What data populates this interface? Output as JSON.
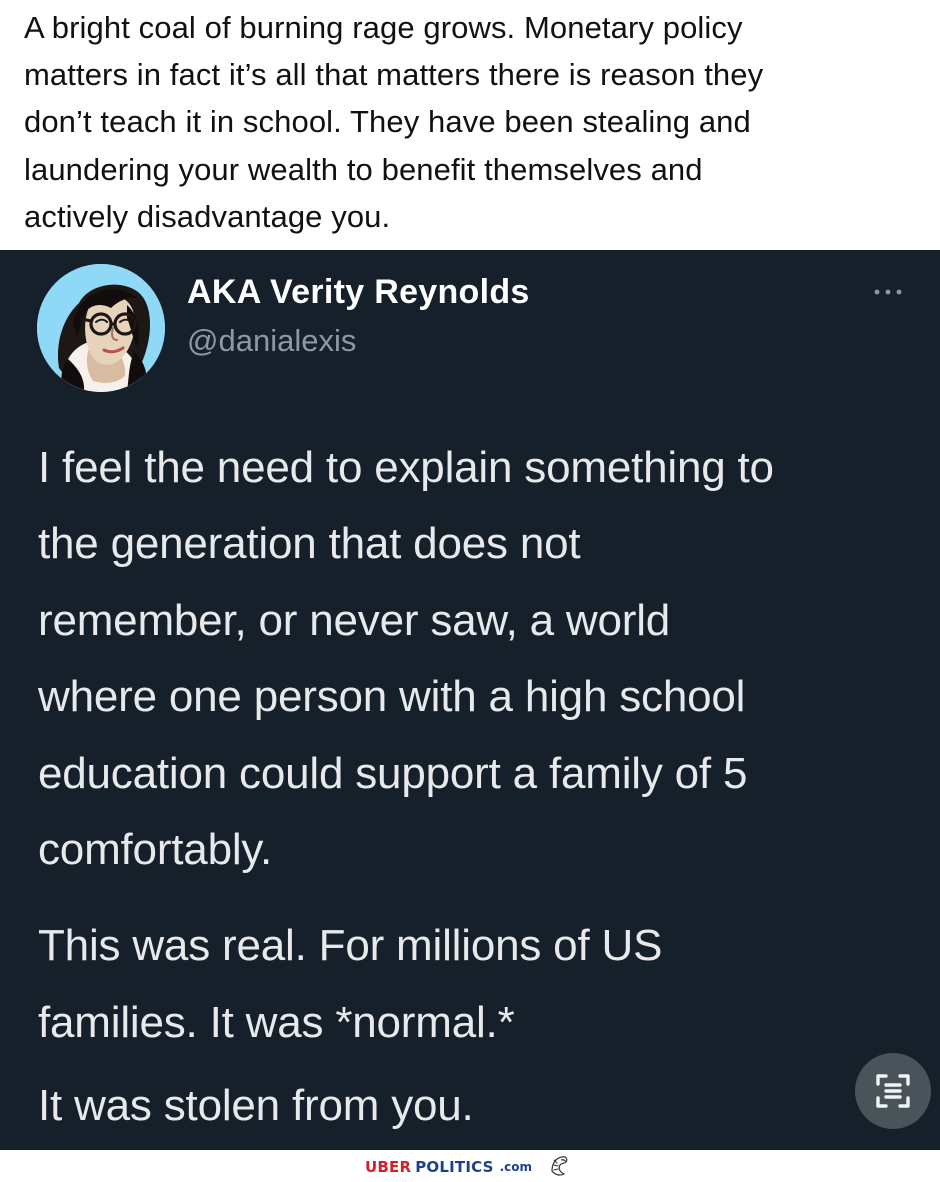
{
  "caption": {
    "lines": [
      "A bright coal of burning rage grows. Monetary policy",
      "matters in fact it’s all that matters there is reason they",
      "don’t teach it in school. They have been stealing and",
      "laundering your wealth to benefit themselves and",
      "actively disadvantage you."
    ]
  },
  "tweet": {
    "display_name": "AKA Verity Reynolds",
    "handle": "@danialexis",
    "more_icon": "more-horizontal-icon",
    "paragraphs": [
      {
        "lines": [
          "I feel the need to explain something to",
          "the generation that does not",
          "remember, or never saw, a world",
          "where one person with a high school",
          "education could support a family of 5",
          "comfortably."
        ]
      },
      {
        "lines": [
          "This was real. For millions of US",
          "families. It was *normal.*"
        ]
      },
      {
        "lines": [
          "It was stolen from you."
        ]
      }
    ],
    "scan_icon": "scan-text-icon"
  },
  "watermark": {
    "brand_prefix": "UBER",
    "brand_main": "POLITICS",
    "brand_tld": ".com",
    "logo_icon": "eagle-icon"
  },
  "colors": {
    "page_background": "#ffffff",
    "caption_text": "#111111",
    "tweet_background": "#15202b",
    "tweet_text": "#e7e9ea",
    "handle_text": "#8b98a5",
    "brand_red": "#d21f2b",
    "brand_blue": "#1d3f8f"
  }
}
